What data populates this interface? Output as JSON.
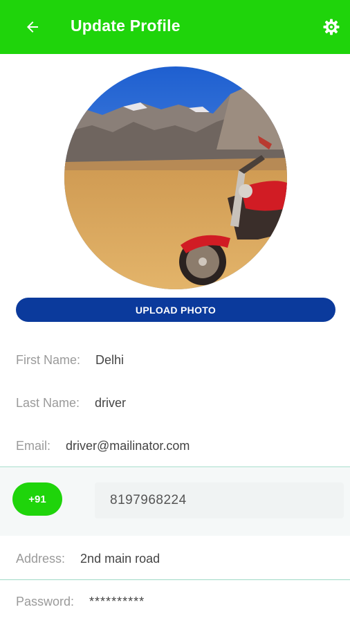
{
  "appbar": {
    "title": "Update Profile",
    "back_icon": "arrow-left-icon",
    "settings_icon": "gear-icon",
    "background": "#1fd40b"
  },
  "profile": {
    "photo": "motorcycle-landscape-photo",
    "upload_label": "UPLOAD PHOTO",
    "upload_color": "#0b3a9c"
  },
  "fields": {
    "first_name": {
      "label": "First Name:",
      "value": "Delhi"
    },
    "last_name": {
      "label": "Last Name:",
      "value": "driver"
    },
    "email": {
      "label": "Email:",
      "value": "driver@mailinator.com"
    },
    "phone": {
      "country_code": "+91",
      "value": "8197968224"
    },
    "address": {
      "label": "Address:",
      "value": "2nd main road"
    },
    "password": {
      "label": "Password:",
      "value": "**********"
    }
  },
  "colors": {
    "accent": "#1fd40b",
    "divider": "#9fd9c6"
  }
}
